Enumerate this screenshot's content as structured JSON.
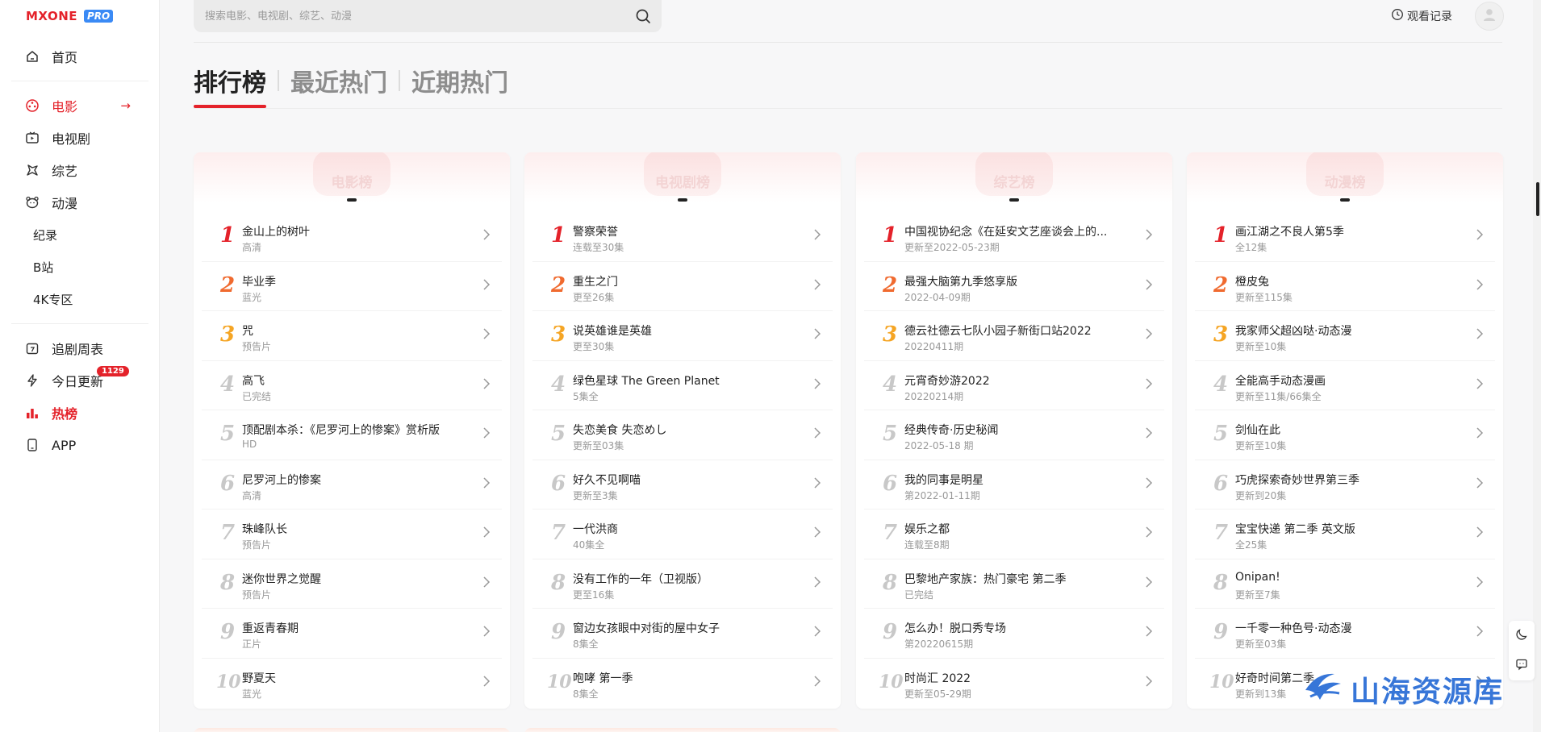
{
  "brand": {
    "name": "MXONE",
    "badge": "PRO"
  },
  "search": {
    "placeholder": "搜索电影、电视剧、综艺、动漫"
  },
  "header": {
    "history_label": "观看记录"
  },
  "sidebar": {
    "items": [
      {
        "label": "首页"
      },
      {
        "label": "电影"
      },
      {
        "label": "电视剧"
      },
      {
        "label": "综艺"
      },
      {
        "label": "动漫"
      },
      {
        "label": "纪录"
      },
      {
        "label": "B站"
      },
      {
        "label": "4K专区"
      },
      {
        "label": "追剧周表"
      },
      {
        "label": "今日更新",
        "badge": "1129"
      },
      {
        "label": "热榜"
      },
      {
        "label": "APP"
      }
    ]
  },
  "tabs": [
    {
      "label": "排行榜"
    },
    {
      "label": "最近热门"
    },
    {
      "label": "近期热门"
    }
  ],
  "accent_color": "#e4222a",
  "rank_colors": [
    "#e4222a",
    "#f06a2f",
    "#f5a524",
    "#c8c8c8"
  ],
  "boards": [
    {
      "title": "电影榜",
      "items": [
        {
          "rank": "1",
          "title": "金山上的树叶",
          "sub": "高清"
        },
        {
          "rank": "2",
          "title": "毕业季",
          "sub": "蓝光"
        },
        {
          "rank": "3",
          "title": "咒",
          "sub": "预告片"
        },
        {
          "rank": "4",
          "title": "高飞",
          "sub": "已完结"
        },
        {
          "rank": "5",
          "title": "顶配剧本杀：《尼罗河上的惨案》赏析版",
          "sub": "HD"
        },
        {
          "rank": "6",
          "title": "尼罗河上的惨案",
          "sub": "高清"
        },
        {
          "rank": "7",
          "title": "珠峰队长",
          "sub": "预告片"
        },
        {
          "rank": "8",
          "title": "迷你世界之觉醒",
          "sub": "预告片"
        },
        {
          "rank": "9",
          "title": "重返青春期",
          "sub": "正片"
        },
        {
          "rank": "10",
          "title": "野夏天",
          "sub": "蓝光"
        }
      ]
    },
    {
      "title": "电视剧榜",
      "items": [
        {
          "rank": "1",
          "title": "警察荣誉",
          "sub": "连载至30集"
        },
        {
          "rank": "2",
          "title": "重生之门",
          "sub": "更至26集"
        },
        {
          "rank": "3",
          "title": "说英雄谁是英雄",
          "sub": "更至30集"
        },
        {
          "rank": "4",
          "title": "绿色星球 The Green Planet",
          "sub": "5集全"
        },
        {
          "rank": "5",
          "title": "失恋美食 失恋めし",
          "sub": "更新至03集"
        },
        {
          "rank": "6",
          "title": "好久不见啊喵",
          "sub": "更新至3集"
        },
        {
          "rank": "7",
          "title": "一代洪商",
          "sub": "40集全"
        },
        {
          "rank": "8",
          "title": "没有工作的一年（卫视版）",
          "sub": "更至16集"
        },
        {
          "rank": "9",
          "title": "窗边女孩眼中对街的屋中女子",
          "sub": "8集全"
        },
        {
          "rank": "10",
          "title": "咆哮 第一季",
          "sub": "8集全"
        }
      ]
    },
    {
      "title": "综艺榜",
      "items": [
        {
          "rank": "1",
          "title": "中国视协纪念《在延安文艺座谈会上的...",
          "sub": "更新至2022-05-23期"
        },
        {
          "rank": "2",
          "title": "最强大脑第九季悠享版",
          "sub": "2022-04-09期"
        },
        {
          "rank": "3",
          "title": "德云社德云七队小园子新街口站2022",
          "sub": "20220411期"
        },
        {
          "rank": "4",
          "title": "元宵奇妙游2022",
          "sub": "20220214期"
        },
        {
          "rank": "5",
          "title": "经典传奇·历史秘闻",
          "sub": "2022-05-18 期"
        },
        {
          "rank": "6",
          "title": "我的同事是明星",
          "sub": "第2022-01-11期"
        },
        {
          "rank": "7",
          "title": "娱乐之都",
          "sub": "连载至8期"
        },
        {
          "rank": "8",
          "title": "巴黎地产家族：热门豪宅 第二季",
          "sub": "已完结"
        },
        {
          "rank": "9",
          "title": "怎么办！脱口秀专场",
          "sub": "第20220615期"
        },
        {
          "rank": "10",
          "title": "时尚汇 2022",
          "sub": "更新至05-29期"
        }
      ]
    },
    {
      "title": "动漫榜",
      "items": [
        {
          "rank": "1",
          "title": "画江湖之不良人第5季",
          "sub": "全12集"
        },
        {
          "rank": "2",
          "title": "橙皮兔",
          "sub": "更新至115集"
        },
        {
          "rank": "3",
          "title": "我家师父超凶哒·动态漫",
          "sub": "更新至10集"
        },
        {
          "rank": "4",
          "title": "全能高手动态漫画",
          "sub": "更新至11集/66集全"
        },
        {
          "rank": "5",
          "title": "剑仙在此",
          "sub": "更新至10集"
        },
        {
          "rank": "6",
          "title": "巧虎探索奇妙世界第三季",
          "sub": "更新到20集"
        },
        {
          "rank": "7",
          "title": "宝宝快递 第二季 英文版",
          "sub": "全25集"
        },
        {
          "rank": "8",
          "title": "Onipan!",
          "sub": "更新至7集"
        },
        {
          "rank": "9",
          "title": "一千零一种色号·动态漫",
          "sub": "更新至03集"
        },
        {
          "rank": "10",
          "title": "好奇时间第二季",
          "sub": "更新到13集"
        }
      ]
    }
  ],
  "watermark": {
    "text": "山海资源库"
  }
}
